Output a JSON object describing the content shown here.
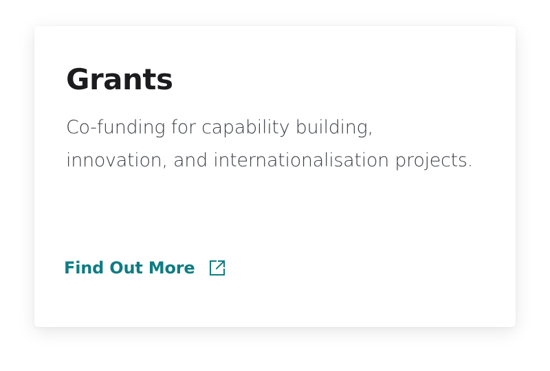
{
  "card": {
    "title": "Grants",
    "description": "Co-funding for capability building, innovation, and internationalisation projects.",
    "cta_label": "Find Out More",
    "cta_icon": "external-link-icon"
  },
  "colors": {
    "title": "#1c1c1e",
    "body_text": "#3a3d42",
    "accent": "#0e7c83",
    "card_background": "#ffffff"
  }
}
